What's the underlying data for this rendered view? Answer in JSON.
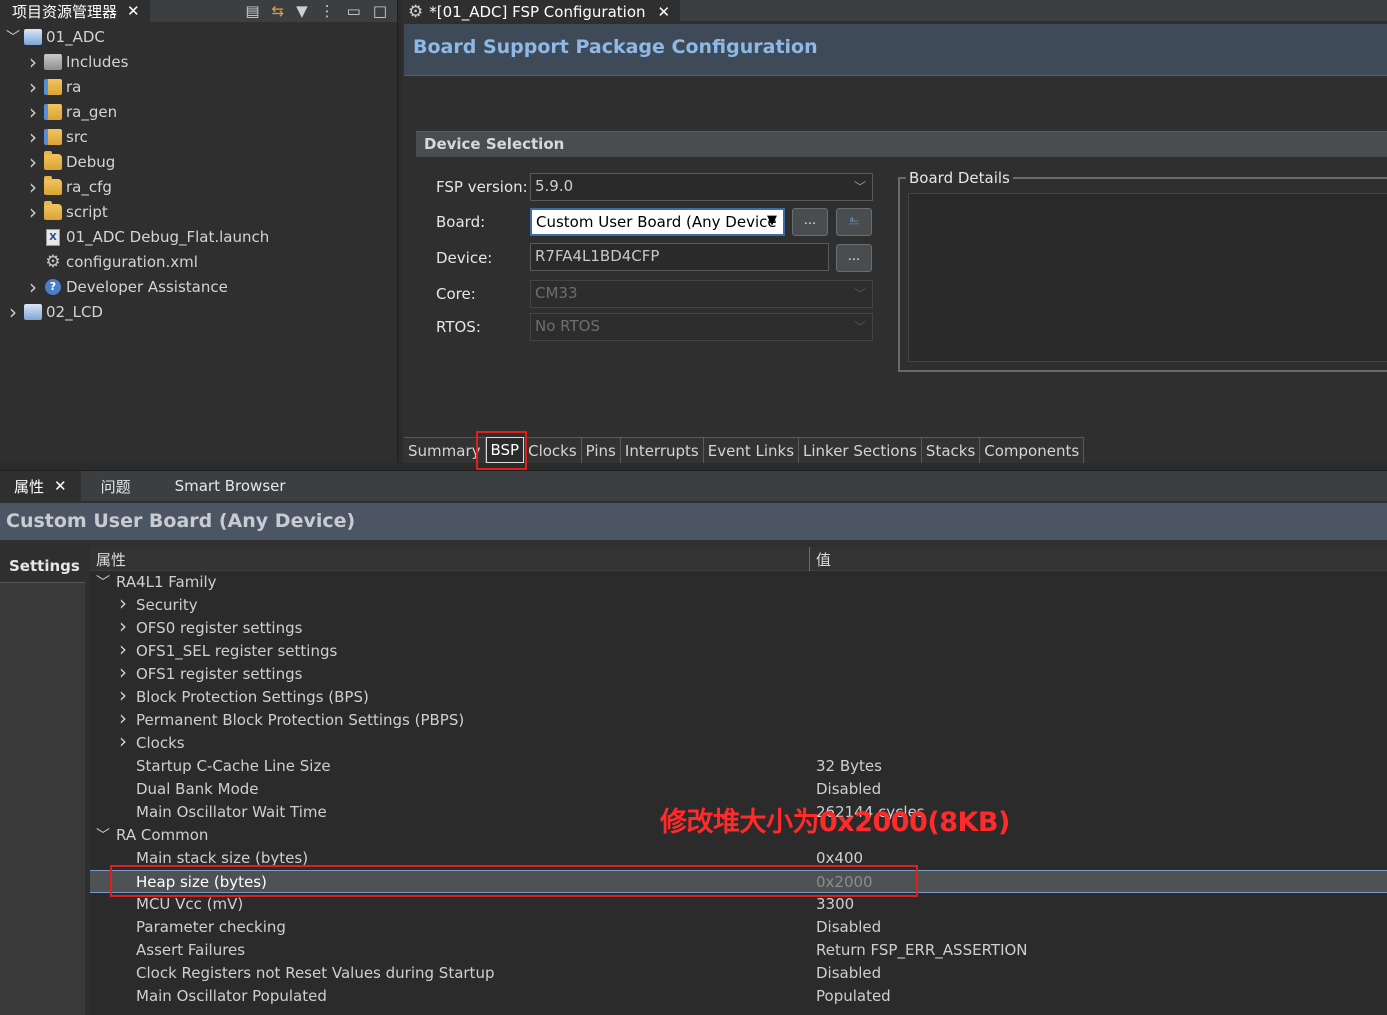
{
  "explorer": {
    "tab_label": "项目资源管理器",
    "tree": [
      {
        "label": "01_ADC",
        "icon": "project-icon"
      },
      {
        "label": "Includes",
        "icon": "includes-icon"
      },
      {
        "label": "ra",
        "icon": "source-folder-icon"
      },
      {
        "label": "ra_gen",
        "icon": "source-folder-icon"
      },
      {
        "label": "src",
        "icon": "source-folder-icon"
      },
      {
        "label": "Debug",
        "icon": "folder-icon"
      },
      {
        "label": "ra_cfg",
        "icon": "folder-icon"
      },
      {
        "label": "script",
        "icon": "folder-icon"
      },
      {
        "label": "01_ADC Debug_Flat.launch",
        "icon": "launch-file-icon"
      },
      {
        "label": "configuration.xml",
        "icon": "gear-icon"
      },
      {
        "label": "Developer Assistance",
        "icon": "help-icon"
      },
      {
        "label": "02_LCD",
        "icon": "project-icon"
      }
    ]
  },
  "editor": {
    "tab_label": "*[01_ADC] FSP Configuration",
    "header": "Board Support Package Configuration",
    "section": "Device Selection",
    "fsp_version_label": "FSP version:",
    "fsp_version": "5.9.0",
    "board_label": "Board:",
    "board": "Custom User Board (Any Device",
    "device_label": "Device:",
    "device": "R7FA4L1BD4CFP",
    "core_label": "Core:",
    "core": "CM33",
    "rtos_label": "RTOS:",
    "rtos": "No RTOS",
    "ellipsis": "...",
    "board_details": "Board Details",
    "page_tabs": [
      "Summary",
      "BSP",
      "Clocks",
      "Pins",
      "Interrupts",
      "Event Links",
      "Linker Sections",
      "Stacks",
      "Components"
    ]
  },
  "props": {
    "tabs": [
      "属性",
      "问题",
      "Smart Browser"
    ],
    "title": "Custom User Board (Any Device)",
    "settings_tab": "Settings",
    "col_property": "属性",
    "col_value": "值",
    "rows": [
      {
        "name": "RA4L1 Family",
        "value": "",
        "level": 0,
        "expand": "open"
      },
      {
        "name": "Security",
        "value": "",
        "level": 1,
        "expand": "closed"
      },
      {
        "name": "OFS0 register settings",
        "value": "",
        "level": 1,
        "expand": "closed"
      },
      {
        "name": "OFS1_SEL register settings",
        "value": "",
        "level": 1,
        "expand": "closed"
      },
      {
        "name": "OFS1 register settings",
        "value": "",
        "level": 1,
        "expand": "closed"
      },
      {
        "name": "Block Protection Settings (BPS)",
        "value": "",
        "level": 1,
        "expand": "closed"
      },
      {
        "name": "Permanent Block Protection Settings (PBPS)",
        "value": "",
        "level": 1,
        "expand": "closed"
      },
      {
        "name": "Clocks",
        "value": "",
        "level": 1,
        "expand": "closed"
      },
      {
        "name": "Startup C-Cache Line Size",
        "value": "32 Bytes",
        "level": 1,
        "expand": "none"
      },
      {
        "name": "Dual Bank Mode",
        "value": "Disabled",
        "level": 1,
        "expand": "none"
      },
      {
        "name": "Main Oscillator Wait Time",
        "value": "262144 cycles",
        "level": 1,
        "expand": "none"
      },
      {
        "name": "RA Common",
        "value": "",
        "level": 0,
        "expand": "open"
      },
      {
        "name": "Main stack size (bytes)",
        "value": "0x400",
        "level": 1,
        "expand": "none"
      },
      {
        "name": "Heap size (bytes)",
        "value": "0x2000",
        "level": 1,
        "expand": "none",
        "selected": true
      },
      {
        "name": "MCU Vcc (mV)",
        "value": "3300",
        "level": 1,
        "expand": "none"
      },
      {
        "name": "Parameter checking",
        "value": "Disabled",
        "level": 1,
        "expand": "none"
      },
      {
        "name": "Assert Failures",
        "value": "Return FSP_ERR_ASSERTION",
        "level": 1,
        "expand": "none"
      },
      {
        "name": "Clock Registers not Reset Values during Startup",
        "value": "Disabled",
        "level": 1,
        "expand": "none"
      },
      {
        "name": "Main Oscillator Populated",
        "value": "Populated",
        "level": 1,
        "expand": "none"
      }
    ]
  },
  "annotation": "修改堆大小为0x2000(8KB)",
  "colors": {
    "accent_header": "#8eb9e6",
    "annotation": "#ff2a2a"
  }
}
